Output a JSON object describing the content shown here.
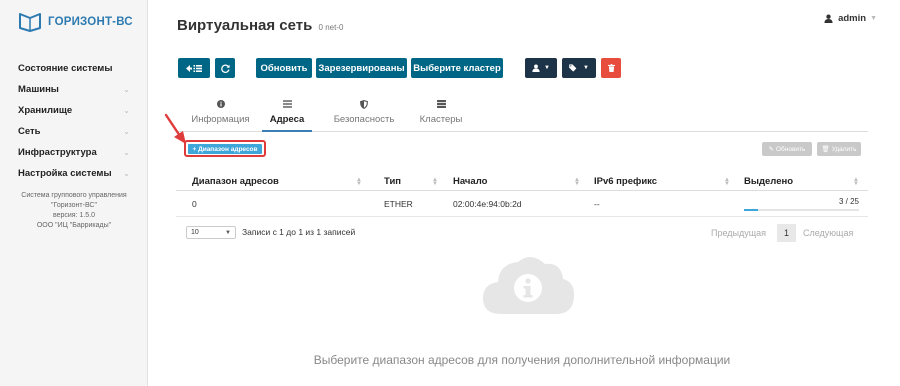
{
  "brand": {
    "name": "ГОРИЗОНТ-ВС"
  },
  "sidebar": {
    "items": [
      {
        "label": "Состояние системы",
        "has_chevron": false
      },
      {
        "label": "Машины",
        "has_chevron": true
      },
      {
        "label": "Хранилище",
        "has_chevron": true
      },
      {
        "label": "Сеть",
        "has_chevron": true
      },
      {
        "label": "Инфраструктура",
        "has_chevron": true
      },
      {
        "label": "Настройка системы",
        "has_chevron": true
      }
    ],
    "info": {
      "line1": "Система группового управления",
      "line2": "\"Горизонт-ВС\"",
      "line3": "версия: 1.5.0",
      "line4": "ООО \"ИЦ \"Баррикады\""
    }
  },
  "header": {
    "title": "Виртуальная сеть",
    "subtitle": "0 net-0",
    "user": "admin"
  },
  "toolbar": {
    "refresh_label": "Обновить",
    "reserved_label": "Зарезервированы",
    "cluster_label": "Выберите кластер"
  },
  "tabs": [
    {
      "label": "Информация",
      "icon": "info-icon"
    },
    {
      "label": "Адреса",
      "icon": "list-icon"
    },
    {
      "label": "Безопасность",
      "icon": "shield-icon"
    },
    {
      "label": "Кластеры",
      "icon": "server-icon"
    }
  ],
  "actions": {
    "add_range": "+ Диапазон адресов",
    "update": "Обновить",
    "delete": "Удалить"
  },
  "table": {
    "headers": [
      "Диапазон адресов",
      "Тип",
      "Начало",
      "IPv6 префикс",
      "Выделено"
    ],
    "rows": [
      {
        "range": "0",
        "type": "ETHER",
        "start": "02:00:4e:94:0b:2d",
        "ipv6": "--",
        "allocated": "3 / 25",
        "allocated_fraction": 0.12
      }
    ]
  },
  "pager": {
    "page_size": "10",
    "info": "Записи с 1 до 1 из 1 записей",
    "prev": "Предыдущая",
    "current": "1",
    "next": "Следующая"
  },
  "empty_state": {
    "text": "Выберите диапазон адресов для получения дополнительной информации"
  },
  "colors": {
    "accent": "#006685",
    "dark": "#1d3347",
    "danger": "#e74c3c",
    "info": "#3fa6d9",
    "highlight": "#e03b3b"
  }
}
